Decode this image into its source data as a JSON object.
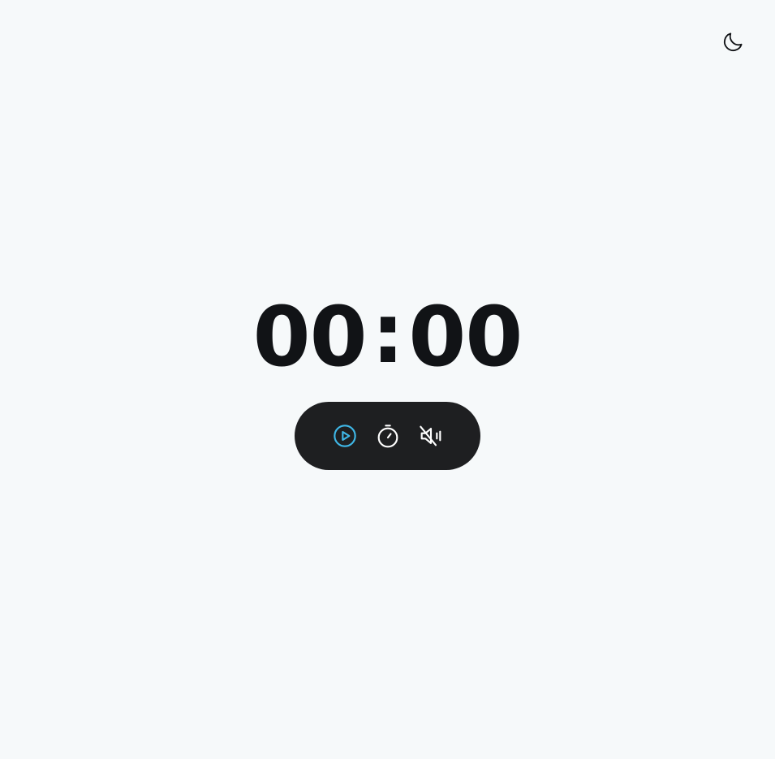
{
  "timer": {
    "minutes": "00",
    "separator": ":",
    "seconds": "00"
  },
  "controls": {
    "play": {
      "icon": "play-circle-icon",
      "color": "#3fb8e8"
    },
    "timer": {
      "icon": "stopwatch-icon",
      "color": "#ffffff"
    },
    "sound": {
      "icon": "volume-muted-icon",
      "color": "#ffffff"
    }
  },
  "header": {
    "theme_toggle_icon": "moon-icon"
  },
  "colors": {
    "background": "#f6f9fa",
    "digits": "#111316",
    "pill": "#1e1f21",
    "accent": "#3fb8e8"
  }
}
